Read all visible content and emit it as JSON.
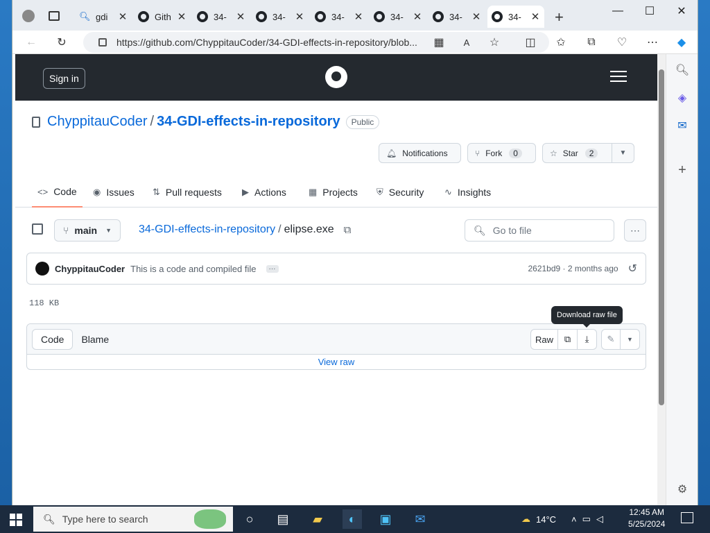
{
  "browser": {
    "tabs": [
      {
        "label": "",
        "icon": "profile-icon"
      },
      {
        "label": "",
        "icon": "tab-actions-icon"
      },
      {
        "label": "gdi",
        "icon": "search-icon"
      },
      {
        "label": "Gith",
        "icon": "github-icon"
      },
      {
        "label": "34-",
        "icon": "github-icon"
      },
      {
        "label": "34-",
        "icon": "github-icon"
      },
      {
        "label": "34-",
        "icon": "github-icon"
      },
      {
        "label": "34-",
        "icon": "github-icon"
      },
      {
        "label": "34-",
        "icon": "github-icon"
      },
      {
        "label": "34-",
        "icon": "github-icon"
      }
    ],
    "new_tab": "+",
    "url": "https://github.com/ChyppitauCoder/34-GDI-effects-in-repository/blob..."
  },
  "github": {
    "sign_in": "Sign in",
    "owner": "ChyppitauCoder",
    "repo": "34-GDI-effects-in-repository",
    "visibility": "Public",
    "notifications": "Notifications",
    "fork": "Fork",
    "fork_count": "0",
    "star": "Star",
    "star_count": "2",
    "nav": [
      {
        "label": "Code",
        "icon": "code-icon"
      },
      {
        "label": "Issues",
        "icon": "issues-icon"
      },
      {
        "label": "Pull requests",
        "icon": "pull-request-icon"
      },
      {
        "label": "Actions",
        "icon": "actions-icon"
      },
      {
        "label": "Projects",
        "icon": "projects-icon"
      },
      {
        "label": "Security",
        "icon": "shield-icon"
      },
      {
        "label": "Insights",
        "icon": "graph-icon"
      }
    ],
    "branch": "main",
    "breadcrumb_repo": "34-GDI-effects-in-repository",
    "breadcrumb_sep": "/",
    "filename": "elipse.exe",
    "go_to_file": "Go to file",
    "commit_author": "ChyppitauCoder",
    "commit_message": "This is a code and compiled file",
    "commit_meta": "2621bd9 · 2 months ago",
    "file_size": "118 KB",
    "tooltip": "Download raw file",
    "tab_code": "Code",
    "tab_blame": "Blame",
    "raw": "Raw",
    "view_raw": "View raw"
  },
  "taskbar": {
    "search_placeholder": "Type here to search",
    "weather": "14°C",
    "time": "12:45 AM",
    "date": "5/25/2024"
  },
  "colors": {
    "accent": "#0969da",
    "header": "#24292f",
    "tab_underline": "#fd8c73"
  }
}
